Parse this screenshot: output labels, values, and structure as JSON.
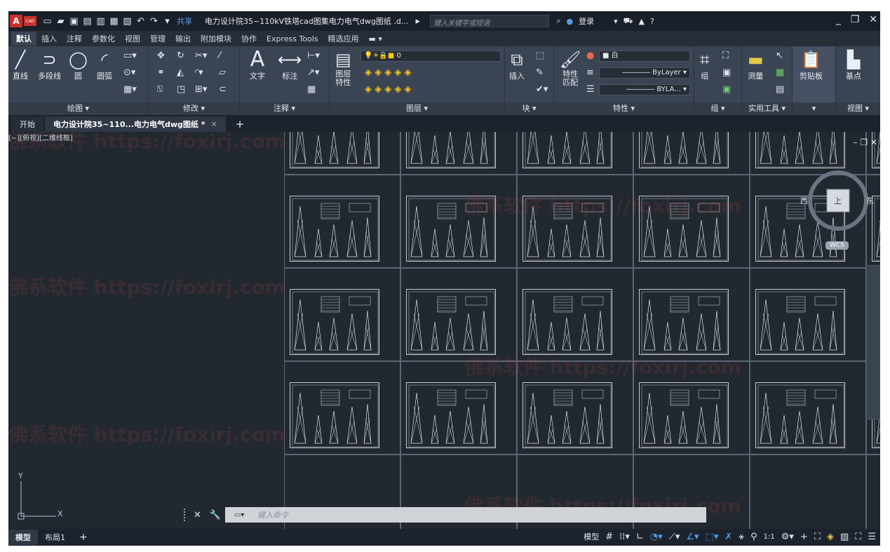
{
  "title_bar": {
    "logo_letter": "A",
    "logo_cad": "CAD",
    "share": "共享",
    "document_title": "电力设计院35~110kV铁塔cad图集电力电气dwg图纸 .d...",
    "search_placeholder": "键入关键字或短语",
    "login": "登录"
  },
  "ribbon_tabs": [
    "默认",
    "插入",
    "注释",
    "参数化",
    "视图",
    "管理",
    "输出",
    "附加模块",
    "协作",
    "Express Tools",
    "精选应用"
  ],
  "panels": {
    "draw": {
      "label": "绘图 ▾",
      "tools": [
        "直线",
        "多段线",
        "圆",
        "圆弧"
      ]
    },
    "modify": {
      "label": "修改 ▾"
    },
    "annotation": {
      "label": "注释 ▾",
      "tools": [
        "文字",
        "标注"
      ]
    },
    "layers": {
      "label": "图层 ▾",
      "layer_props": "图层\n特性",
      "current_layer": "0"
    },
    "block": {
      "label": "块 ▾",
      "insert": "插入"
    },
    "properties": {
      "label": "特性 ▾",
      "match": "特性\n匹配",
      "color": "白",
      "linetype": "ByLayer",
      "lineweight": "BYLA..."
    },
    "groups": {
      "label": "组 ▾",
      "group": "组"
    },
    "utilities": {
      "label": "实用工具 ▾",
      "measure": "测量"
    },
    "clipboard": {
      "label": "▾",
      "paste": "剪贴板"
    },
    "view": {
      "label": "视图 ▾",
      "base": "基点"
    }
  },
  "doc_tabs": [
    "开始",
    "电力设计院35~110...电力电气dwg图纸 *"
  ],
  "canvas": {
    "view_label": "[−][俯视][二维线框]",
    "viewcube": {
      "west": "西",
      "east": "东",
      "top": "上",
      "wcs": "WCS"
    },
    "ucs_x": "X",
    "ucs_y": "Y",
    "watermark": "佛系软件 https://foxirj.com"
  },
  "command_line": {
    "placeholder": "键入命令"
  },
  "status_bar": {
    "layout_tabs": [
      "模型",
      "布局1"
    ],
    "model_label": "模型",
    "scale": "1:1"
  },
  "colors": {
    "background": "#212830",
    "ribbon": "#3b4453",
    "accent": "#4fa3f0",
    "logo": "#c8302c"
  }
}
